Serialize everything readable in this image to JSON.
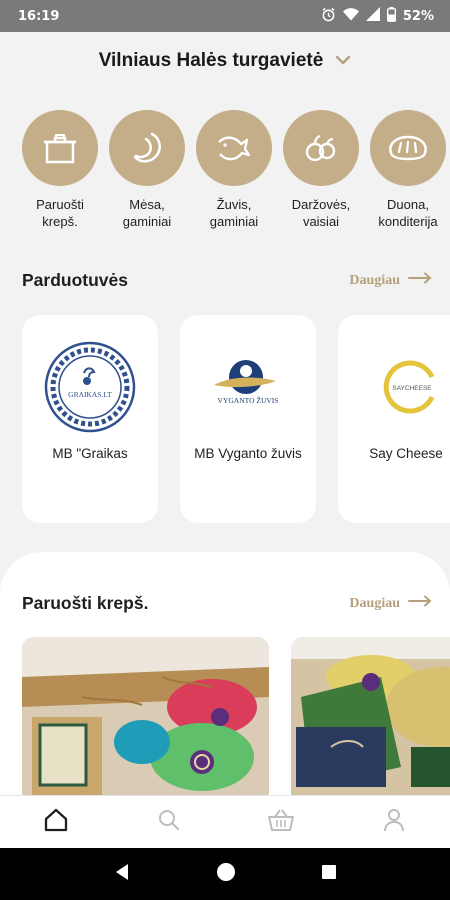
{
  "status_bar": {
    "time": "16:19",
    "battery": "52%"
  },
  "market": {
    "name": "Vilniaus Halės turgavietė"
  },
  "categories": [
    {
      "label": "Paruošti krepš.",
      "icon": "pot-icon"
    },
    {
      "label": "Mėsa, gaminiai",
      "icon": "sausage-icon"
    },
    {
      "label": "Žuvis, gaminiai",
      "icon": "fish-icon"
    },
    {
      "label": "Daržovės, vaisiai",
      "icon": "fruit-icon"
    },
    {
      "label": "Duona, konditerija",
      "icon": "bread-icon"
    }
  ],
  "shops_section": {
    "title": "Parduotuvės",
    "more": "Daugiau"
  },
  "shops": [
    {
      "name": "MB \"Graikas",
      "logo_text": "GRAIKAS.LT"
    },
    {
      "name": "MB Vyganto žuvis",
      "logo_text": "VYGANTO ŽUVIS"
    },
    {
      "name": "Say Cheese",
      "logo_text": "SAYCHEESE"
    }
  ],
  "baskets_section": {
    "title": "Paruošti krepš.",
    "more": "Daugiau"
  },
  "baskets": [
    {
      "image": "cheese-basket-photo"
    },
    {
      "image": "cheese-basket-photo-2"
    }
  ],
  "bottom_nav": [
    {
      "id": "home",
      "icon": "home-icon",
      "active": true
    },
    {
      "id": "search",
      "icon": "search-icon",
      "active": false
    },
    {
      "id": "basket",
      "icon": "basket-icon",
      "active": false
    },
    {
      "id": "profile",
      "icon": "user-icon",
      "active": false
    }
  ],
  "colors": {
    "accent": "#c4ae8a",
    "accent_text": "#b6a07c",
    "background": "#f2f2f2"
  }
}
